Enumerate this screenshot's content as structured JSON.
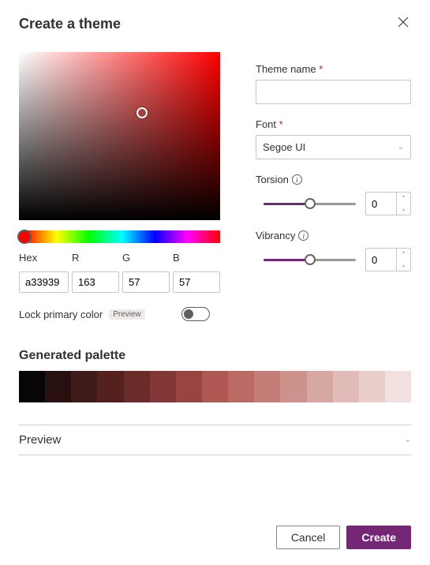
{
  "header": {
    "title": "Create a theme"
  },
  "picker": {
    "labels": {
      "hex": "Hex",
      "r": "R",
      "g": "G",
      "b": "B"
    },
    "values": {
      "hex": "a33939",
      "r": "163",
      "g": "57",
      "b": "57"
    },
    "lock_label": "Lock primary color",
    "badge": "Preview"
  },
  "settings": {
    "theme_name_label": "Theme name",
    "theme_name_value": "",
    "font_label": "Font",
    "font_value": "Segoe UI",
    "torsion_label": "Torsion",
    "torsion_value": "0",
    "vibrancy_label": "Vibrancy",
    "vibrancy_value": "0",
    "required_marker": "*"
  },
  "palette": {
    "title": "Generated palette",
    "colors": [
      "#070505",
      "#281010",
      "#3e1a19",
      "#55211f",
      "#6b2b29",
      "#823635",
      "#9a4441",
      "#b05954",
      "#bb6a64",
      "#c37e77",
      "#ce928c",
      "#d7a7a1",
      "#e1bbb7",
      "#eacecb",
      "#f2e0de"
    ]
  },
  "preview": {
    "title": "Preview"
  },
  "footer": {
    "cancel": "Cancel",
    "create": "Create"
  }
}
